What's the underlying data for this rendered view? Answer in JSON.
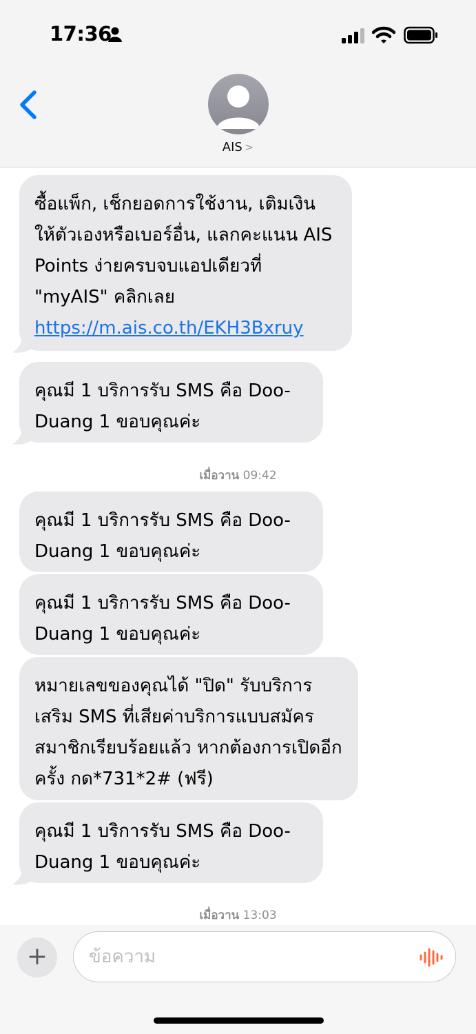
{
  "status_bar": {
    "time": "17:36",
    "icons": [
      "person-icon",
      "signal-icon",
      "wifi-icon",
      "battery-icon"
    ]
  },
  "header": {
    "contact_name": "AIS",
    "chevron": ">",
    "icons": [
      "back-chevron-icon",
      "avatar-icon"
    ]
  },
  "messages": [
    {
      "type": "received",
      "text_before_link": "ซื้อแพ็ก, เช็กยอดการใช้งาน, เติมเงิน ให้ตัวเองหรือเบอร์อื่น, แลกคะแนน AIS Points ง่ายครบจบแอปเดียวที่ \"myAIS\" คลิกเลย ",
      "link": "https://m.ais.co.th/EKH3Bxruy"
    },
    {
      "type": "received",
      "text": "คุณมี 1 บริการรับ SMS คือ Doo-Duang 1 ขอบคุณค่ะ"
    }
  ],
  "timestamp_1": {
    "day": "เมื่อวาน",
    "time": "09:42"
  },
  "messages_2": [
    {
      "type": "received",
      "text": "คุณมี 1 บริการรับ SMS คือ Doo-Duang 1 ขอบคุณค่ะ"
    },
    {
      "type": "received",
      "text": "คุณมี 1 บริการรับ SMS คือ Doo-Duang 1 ขอบคุณค่ะ"
    },
    {
      "type": "received",
      "text": "หมายเลขของคุณได้ \"ปิด\" รับบริการเสริม SMS ที่เสียค่าบริการแบบสมัครสมาชิกเรียบร้อยแล้ว หากต้องการเปิดอีกครั้ง กด*731*2# (ฟรี)"
    },
    {
      "type": "received",
      "text": "คุณมี 1 บริการรับ SMS คือ Doo-Duang 1 ขอบคุณค่ะ"
    }
  ],
  "timestamp_2": {
    "day": "เมื่อวาน",
    "time": "13:03"
  },
  "input_bar": {
    "plus_label": "+",
    "placeholder": "ข้อความ",
    "icons": [
      "plus-icon",
      "voice-waveform-icon"
    ]
  },
  "colors": {
    "accent": "#007aff",
    "bubble": "#e9e9eb",
    "link": "#1a73e8",
    "mic": "#ff6b3d"
  }
}
